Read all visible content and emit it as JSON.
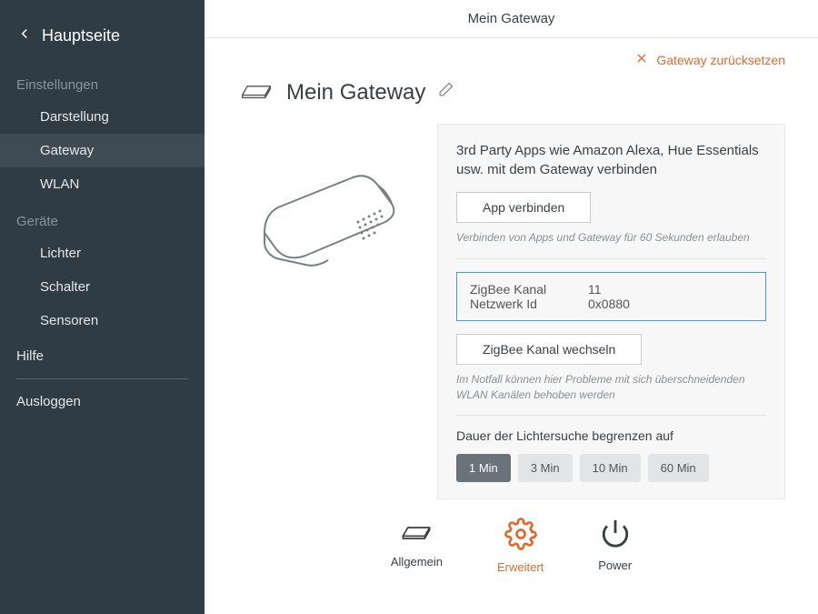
{
  "sidebar": {
    "back_label": "Hauptseite",
    "section_settings": "Einstellungen",
    "items_settings": [
      "Darstellung",
      "Gateway",
      "WLAN"
    ],
    "section_devices": "Geräte",
    "items_devices": [
      "Lichter",
      "Schalter",
      "Sensoren"
    ],
    "help": "Hilfe",
    "logout": "Ausloggen"
  },
  "topbar": {
    "title": "Mein Gateway"
  },
  "reset": {
    "label": "Gateway zurücksetzen"
  },
  "page": {
    "title": "Mein Gateway"
  },
  "connect": {
    "desc": "3rd Party Apps wie Amazon Alexa, Hue Essentials usw. mit dem Gateway verbinden",
    "button": "App verbinden",
    "hint": "Verbinden von Apps und Gateway für 60 Sekunden erlauben"
  },
  "zigbee": {
    "channel_label": "ZigBee Kanal",
    "channel_value": "11",
    "netid_label": "Netzwerk Id",
    "netid_value": "0x0880",
    "change_button": "ZigBee Kanal wechseln",
    "hint": "Im Notfall können hier Probleme mit sich überschneidenden WLAN Kanälen behoben werden"
  },
  "duration": {
    "label": "Dauer der Lichtersuche begrenzen auf",
    "options": [
      "1 Min",
      "3 Min",
      "10 Min",
      "60 Min"
    ],
    "active": 0
  },
  "tabs": {
    "items": [
      "Allgemein",
      "Erweitert",
      "Power"
    ],
    "active": 1
  },
  "colors": {
    "accent": "#e16a2d",
    "highlight": "#3fa0d8"
  }
}
